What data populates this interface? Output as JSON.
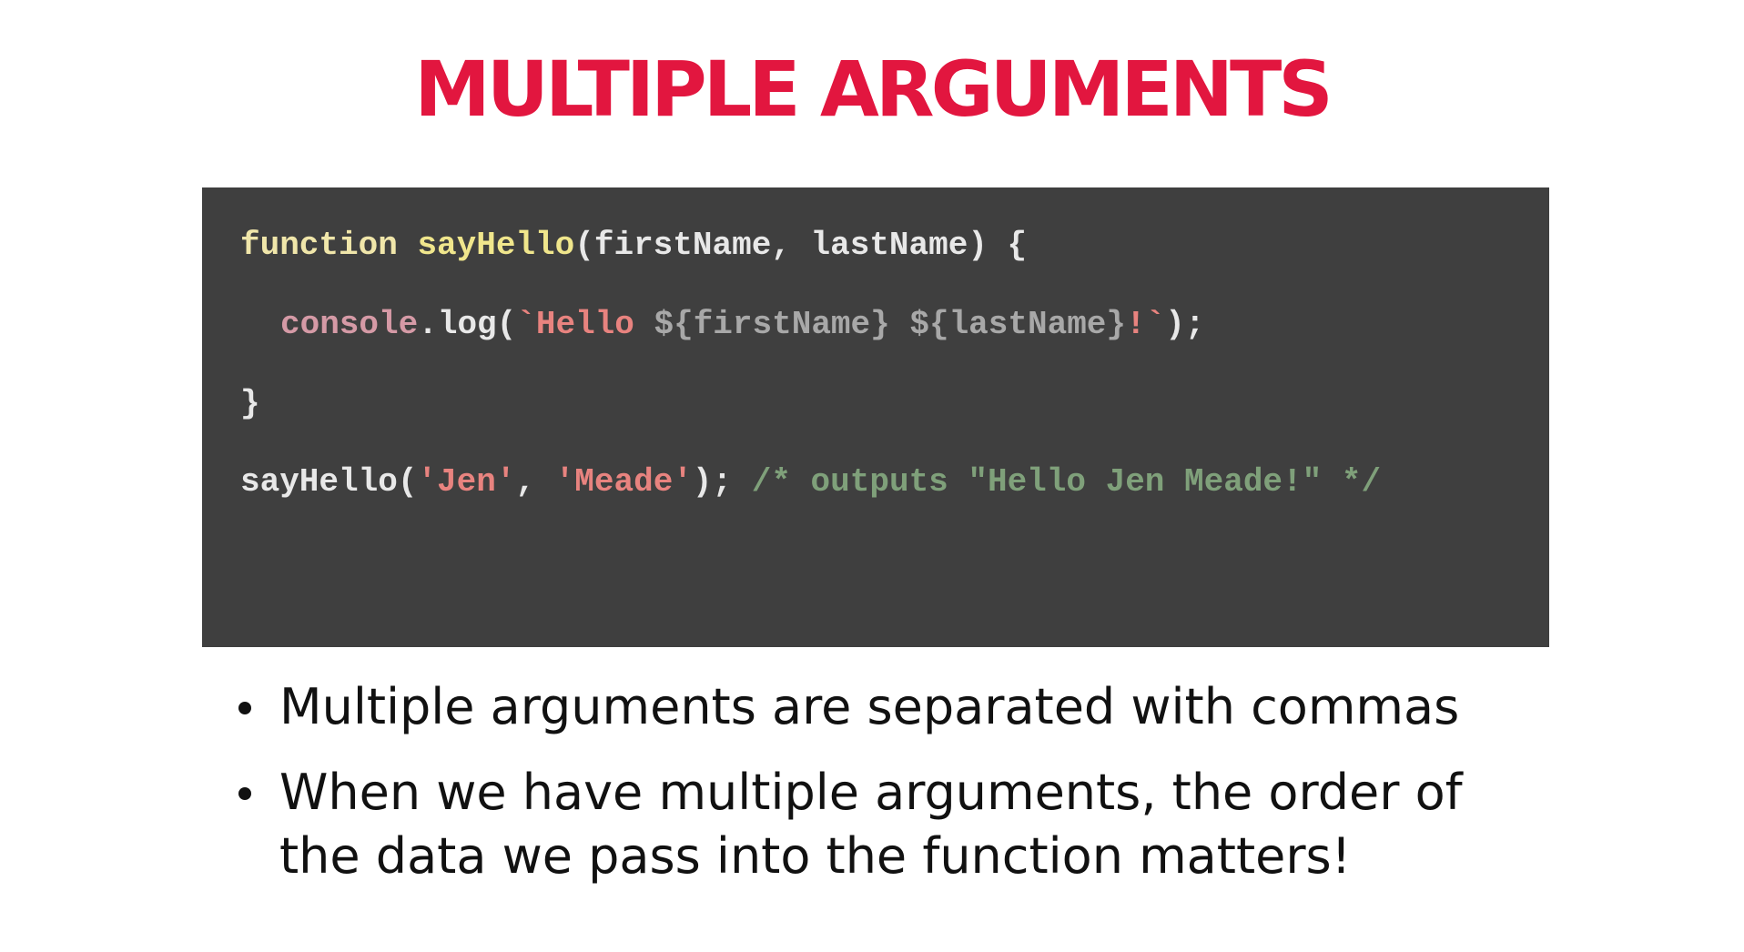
{
  "slide": {
    "title": "MULTIPLE ARGUMENTS"
  },
  "colors": {
    "title": "#e2163f",
    "code_background": "#3f3f3f",
    "code_default": "#e8e8e8",
    "code_keyword": "#f0e6aa",
    "code_function_name": "#f0e68c",
    "code_builtin": "#d59aa6",
    "code_string": "#e8837f",
    "code_interpolation": "#a8a8a8",
    "code_comment": "#7fa07a"
  },
  "code": {
    "line1": {
      "keyword": "function",
      "space": " ",
      "name": "sayHello",
      "params": "(firstName, lastName) {"
    },
    "line2": {
      "object": "console",
      "method": ".log(",
      "template_start": "`Hello ",
      "interp1": "${firstName}",
      "space": " ",
      "interp2": "${lastName}",
      "template_end": "!`",
      "close": ");"
    },
    "line3": {
      "brace": "}"
    },
    "line4": {
      "call": "sayHello(",
      "arg1": "'Jen'",
      "comma": ", ",
      "arg2": "'Meade'",
      "close": "); ",
      "comment": "/* outputs \"Hello Jen Meade!\" */"
    }
  },
  "bullets": [
    {
      "text": "Multiple arguments are separated with commas"
    },
    {
      "text": "When we have multiple arguments, the order of the data we pass into the function matters!"
    }
  ]
}
